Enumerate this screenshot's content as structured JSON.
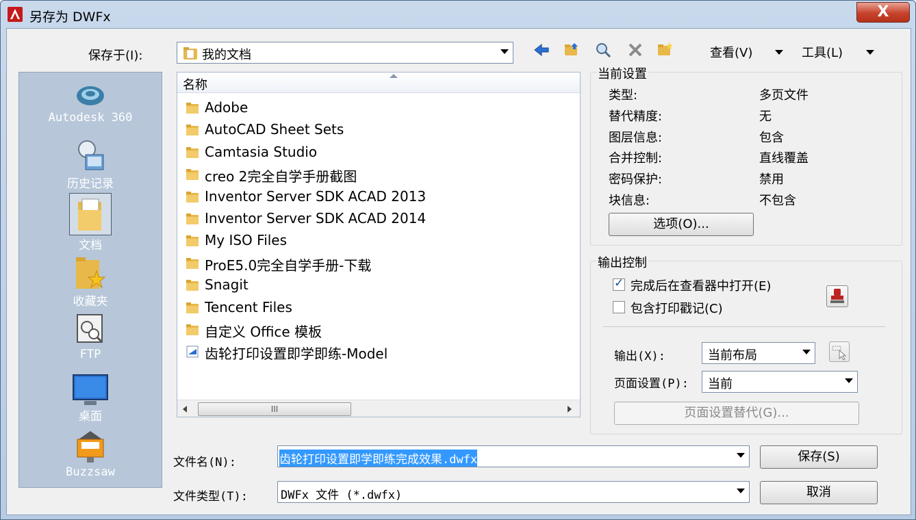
{
  "window": {
    "title": "另存为 DWFx",
    "close_label": "X"
  },
  "toolbar": {
    "save_in_label": "保存于(I):",
    "save_in_value": "我的文档",
    "view_menu": "查看(V)",
    "tools_menu": "工具(L)",
    "icons": [
      "back-arrow-icon",
      "up-folder-icon",
      "search-web-icon",
      "delete-icon",
      "new-folder-icon"
    ]
  },
  "places": [
    {
      "label": "Autodesk 360",
      "icon": "cloud-icon"
    },
    {
      "label": "历史记录",
      "icon": "history-icon"
    },
    {
      "label": "文档",
      "icon": "documents-icon"
    },
    {
      "label": "收藏夹",
      "icon": "favorites-icon"
    },
    {
      "label": "FTP",
      "icon": "ftp-icon"
    },
    {
      "label": "桌面",
      "icon": "desktop-icon"
    },
    {
      "label": "Buzzsaw",
      "icon": "buzzsaw-icon"
    }
  ],
  "filelist": {
    "column_name": "名称",
    "items": [
      {
        "name": "Adobe",
        "type": "folder"
      },
      {
        "name": "AutoCAD Sheet Sets",
        "type": "folder"
      },
      {
        "name": "Camtasia Studio",
        "type": "folder"
      },
      {
        "name": "creo 2完全自学手册截图",
        "type": "folder"
      },
      {
        "name": "Inventor Server SDK ACAD 2013",
        "type": "folder"
      },
      {
        "name": "Inventor Server SDK ACAD 2014",
        "type": "folder"
      },
      {
        "name": "My ISO Files",
        "type": "folder"
      },
      {
        "name": "ProE5.0完全自学手册-下载",
        "type": "folder"
      },
      {
        "name": "Snagit",
        "type": "folder"
      },
      {
        "name": "Tencent Files",
        "type": "folder"
      },
      {
        "name": "自定义 Office 模板",
        "type": "folder"
      },
      {
        "name": "齿轮打印设置即学即练-Model",
        "type": "file"
      }
    ],
    "scroll_thumb_label": "III"
  },
  "current_settings": {
    "title": "当前设置",
    "rows": [
      {
        "label": "类型:",
        "value": "多页文件"
      },
      {
        "label": "替代精度:",
        "value": "无"
      },
      {
        "label": "图层信息:",
        "value": "包含"
      },
      {
        "label": "合并控制:",
        "value": "直线覆盖"
      },
      {
        "label": "密码保护:",
        "value": "禁用"
      },
      {
        "label": "块信息:",
        "value": "不包含"
      }
    ],
    "options_button": "选项(O)..."
  },
  "output_control": {
    "title": "输出控制",
    "open_in_viewer_label": "完成后在查看器中打开(E)",
    "open_in_viewer_checked": true,
    "include_stamp_label": "包含打印戳记(C)",
    "include_stamp_checked": false,
    "output_label": "输出(X):",
    "output_value": "当前布局",
    "page_setup_label": "页面设置(P):",
    "page_setup_value": "当前",
    "page_setup_override_button": "页面设置替代(G)..."
  },
  "footer": {
    "filename_label": "文件名(N):",
    "filename_value": "齿轮打印设置即学即练完成效果.dwfx",
    "filetype_label": "文件类型(T):",
    "filetype_value": "DWFx 文件 (*.dwfx)",
    "save_button": "保存(S)",
    "cancel_button": "取消"
  },
  "colors": {
    "accent": "#3399ff",
    "title_bar": "#c9d9ec",
    "places_bg": "#b7c7d9",
    "folder": "#e8b84a",
    "close": "#c7432c"
  }
}
